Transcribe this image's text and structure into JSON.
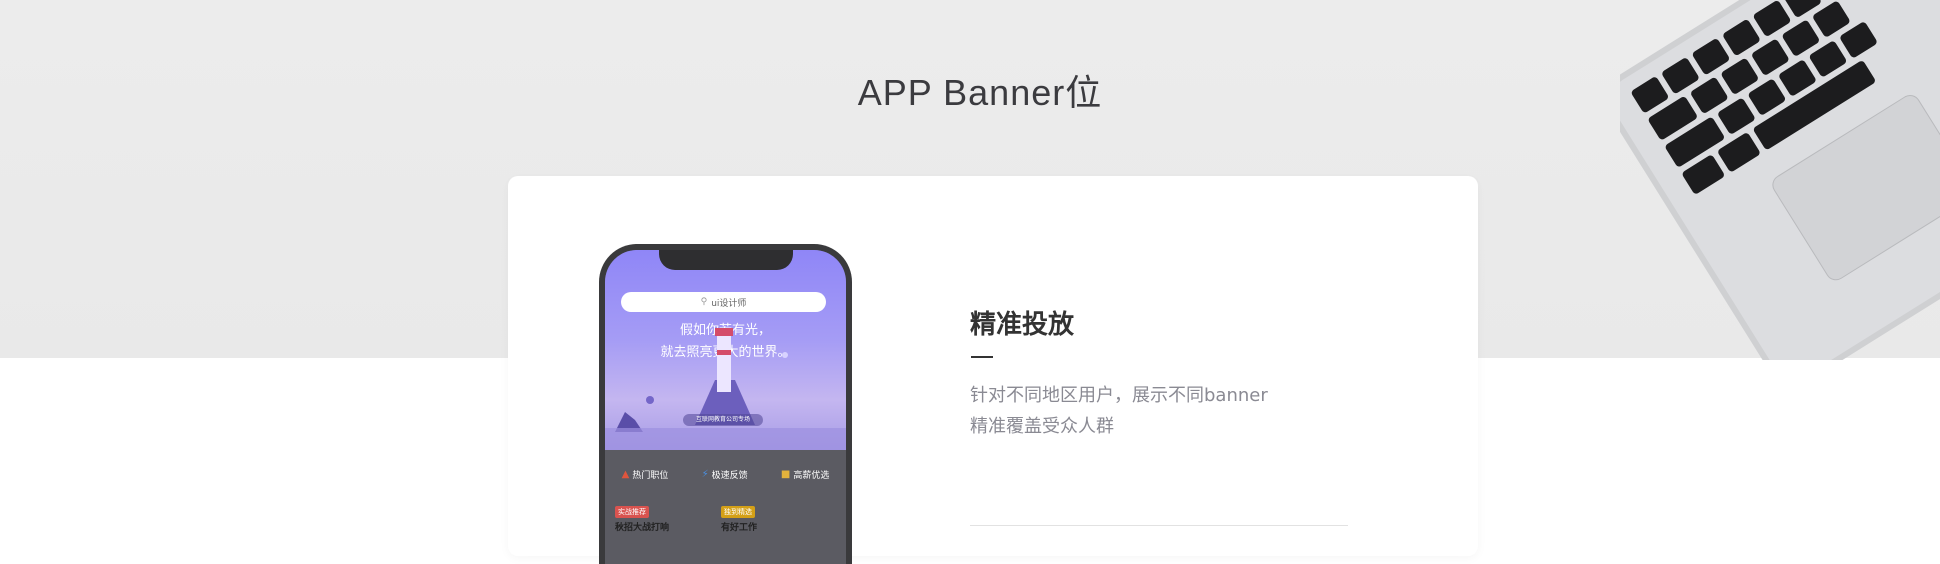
{
  "page": {
    "title": "APP Banner位"
  },
  "phone": {
    "search_placeholder": "ui设计师",
    "banner_line1": "假如你若有光，",
    "banner_line2": "就去照亮更大的世界。",
    "banner_caption": "互联网教育公司专场",
    "quick_links": [
      {
        "icon": "flame-icon",
        "label": "热门职位"
      },
      {
        "icon": "lightning-icon",
        "label": "极速反馈"
      },
      {
        "icon": "briefcase-icon",
        "label": "高薪优选"
      }
    ],
    "tags": [
      {
        "label": "实战推荐",
        "color": "#d9534f",
        "sub": "秋招大战打响"
      },
      {
        "label": "独到精选",
        "color": "#d4a017",
        "sub": "有好工作"
      }
    ]
  },
  "feature": {
    "title": "精准投放",
    "lines": [
      "针对不同地区用户，展示不同banner",
      "精准覆盖受众人群"
    ]
  },
  "colors": {
    "banner_accent": "#8f86f7",
    "title_text": "#3b3b3f",
    "body_text": "#8a8a93"
  }
}
